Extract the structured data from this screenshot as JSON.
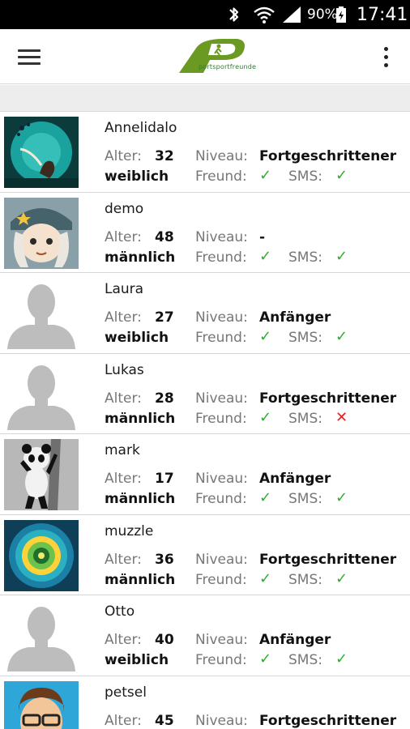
{
  "status_bar": {
    "battery_percent": "90%",
    "time": "17:41",
    "icons": [
      "bluetooth-icon",
      "wifi-icon",
      "signal-icon",
      "battery-icon"
    ]
  },
  "app_bar": {
    "menu_icon": "hamburger-menu-icon",
    "logo_text": "portsportfreunde",
    "overflow_icon": "more-vert-icon",
    "brand_color": "#6a9a22"
  },
  "labels": {
    "age": "Alter:",
    "level": "Niveau:",
    "friend": "Freund:",
    "sms": "SMS:"
  },
  "colors": {
    "check": "#2eae2e",
    "cross": "#e02424"
  },
  "users": [
    {
      "name": "Annelidalo",
      "age": "32",
      "level": "Fortgeschrittener",
      "gender": "weiblich",
      "friend": "✓",
      "friend_ok": true,
      "sms": "✓",
      "sms_ok": true,
      "avatar": "photo-mermaid"
    },
    {
      "name": "demo",
      "age": "48",
      "level": "-",
      "gender": "männlich",
      "friend": "✓",
      "friend_ok": true,
      "sms": "✓",
      "sms_ok": true,
      "avatar": "cartoon-soldier"
    },
    {
      "name": "Laura",
      "age": "27",
      "level": "Anfänger",
      "gender": "weiblich",
      "friend": "✓",
      "friend_ok": true,
      "sms": "✓",
      "sms_ok": true,
      "avatar": "placeholder-person"
    },
    {
      "name": "Lukas",
      "age": "28",
      "level": "Fortgeschrittener",
      "gender": "männlich",
      "friend": "✓",
      "friend_ok": true,
      "sms": "✕",
      "sms_ok": false,
      "avatar": "placeholder-person"
    },
    {
      "name": "mark",
      "age": "17",
      "level": "Anfänger",
      "gender": "männlich",
      "friend": "✓",
      "friend_ok": true,
      "sms": "✓",
      "sms_ok": true,
      "avatar": "photo-panda"
    },
    {
      "name": "muzzle",
      "age": "36",
      "level": "Fortgeschrittener",
      "gender": "männlich",
      "friend": "✓",
      "friend_ok": true,
      "sms": "✓",
      "sms_ok": true,
      "avatar": "photo-mandala"
    },
    {
      "name": "Otto",
      "age": "40",
      "level": "Anfänger",
      "gender": "weiblich",
      "friend": "✓",
      "friend_ok": true,
      "sms": "✓",
      "sms_ok": true,
      "avatar": "placeholder-person"
    },
    {
      "name": "petsel",
      "age": "45",
      "level": "Fortgeschrittener",
      "gender": "",
      "friend": "",
      "friend_ok": true,
      "sms": "",
      "sms_ok": true,
      "avatar": "cartoon-glasses"
    }
  ]
}
